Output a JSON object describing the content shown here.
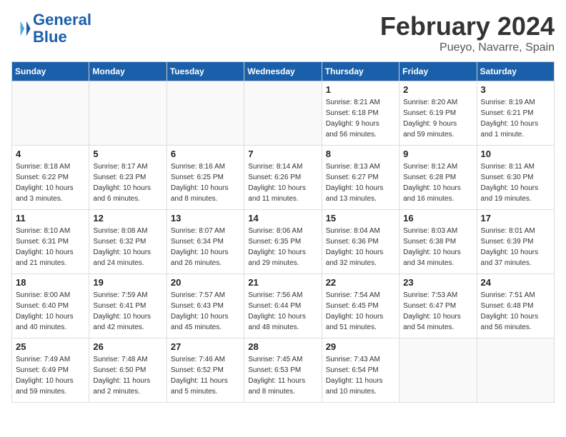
{
  "header": {
    "logo_line1": "General",
    "logo_line2": "Blue",
    "month_year": "February 2024",
    "location": "Pueyo, Navarre, Spain"
  },
  "days_of_week": [
    "Sunday",
    "Monday",
    "Tuesday",
    "Wednesday",
    "Thursday",
    "Friday",
    "Saturday"
  ],
  "weeks": [
    [
      {
        "day": "",
        "info": ""
      },
      {
        "day": "",
        "info": ""
      },
      {
        "day": "",
        "info": ""
      },
      {
        "day": "",
        "info": ""
      },
      {
        "day": "1",
        "info": "Sunrise: 8:21 AM\nSunset: 6:18 PM\nDaylight: 9 hours\nand 56 minutes."
      },
      {
        "day": "2",
        "info": "Sunrise: 8:20 AM\nSunset: 6:19 PM\nDaylight: 9 hours\nand 59 minutes."
      },
      {
        "day": "3",
        "info": "Sunrise: 8:19 AM\nSunset: 6:21 PM\nDaylight: 10 hours\nand 1 minute."
      }
    ],
    [
      {
        "day": "4",
        "info": "Sunrise: 8:18 AM\nSunset: 6:22 PM\nDaylight: 10 hours\nand 3 minutes."
      },
      {
        "day": "5",
        "info": "Sunrise: 8:17 AM\nSunset: 6:23 PM\nDaylight: 10 hours\nand 6 minutes."
      },
      {
        "day": "6",
        "info": "Sunrise: 8:16 AM\nSunset: 6:25 PM\nDaylight: 10 hours\nand 8 minutes."
      },
      {
        "day": "7",
        "info": "Sunrise: 8:14 AM\nSunset: 6:26 PM\nDaylight: 10 hours\nand 11 minutes."
      },
      {
        "day": "8",
        "info": "Sunrise: 8:13 AM\nSunset: 6:27 PM\nDaylight: 10 hours\nand 13 minutes."
      },
      {
        "day": "9",
        "info": "Sunrise: 8:12 AM\nSunset: 6:28 PM\nDaylight: 10 hours\nand 16 minutes."
      },
      {
        "day": "10",
        "info": "Sunrise: 8:11 AM\nSunset: 6:30 PM\nDaylight: 10 hours\nand 19 minutes."
      }
    ],
    [
      {
        "day": "11",
        "info": "Sunrise: 8:10 AM\nSunset: 6:31 PM\nDaylight: 10 hours\nand 21 minutes."
      },
      {
        "day": "12",
        "info": "Sunrise: 8:08 AM\nSunset: 6:32 PM\nDaylight: 10 hours\nand 24 minutes."
      },
      {
        "day": "13",
        "info": "Sunrise: 8:07 AM\nSunset: 6:34 PM\nDaylight: 10 hours\nand 26 minutes."
      },
      {
        "day": "14",
        "info": "Sunrise: 8:06 AM\nSunset: 6:35 PM\nDaylight: 10 hours\nand 29 minutes."
      },
      {
        "day": "15",
        "info": "Sunrise: 8:04 AM\nSunset: 6:36 PM\nDaylight: 10 hours\nand 32 minutes."
      },
      {
        "day": "16",
        "info": "Sunrise: 8:03 AM\nSunset: 6:38 PM\nDaylight: 10 hours\nand 34 minutes."
      },
      {
        "day": "17",
        "info": "Sunrise: 8:01 AM\nSunset: 6:39 PM\nDaylight: 10 hours\nand 37 minutes."
      }
    ],
    [
      {
        "day": "18",
        "info": "Sunrise: 8:00 AM\nSunset: 6:40 PM\nDaylight: 10 hours\nand 40 minutes."
      },
      {
        "day": "19",
        "info": "Sunrise: 7:59 AM\nSunset: 6:41 PM\nDaylight: 10 hours\nand 42 minutes."
      },
      {
        "day": "20",
        "info": "Sunrise: 7:57 AM\nSunset: 6:43 PM\nDaylight: 10 hours\nand 45 minutes."
      },
      {
        "day": "21",
        "info": "Sunrise: 7:56 AM\nSunset: 6:44 PM\nDaylight: 10 hours\nand 48 minutes."
      },
      {
        "day": "22",
        "info": "Sunrise: 7:54 AM\nSunset: 6:45 PM\nDaylight: 10 hours\nand 51 minutes."
      },
      {
        "day": "23",
        "info": "Sunrise: 7:53 AM\nSunset: 6:47 PM\nDaylight: 10 hours\nand 54 minutes."
      },
      {
        "day": "24",
        "info": "Sunrise: 7:51 AM\nSunset: 6:48 PM\nDaylight: 10 hours\nand 56 minutes."
      }
    ],
    [
      {
        "day": "25",
        "info": "Sunrise: 7:49 AM\nSunset: 6:49 PM\nDaylight: 10 hours\nand 59 minutes."
      },
      {
        "day": "26",
        "info": "Sunrise: 7:48 AM\nSunset: 6:50 PM\nDaylight: 11 hours\nand 2 minutes."
      },
      {
        "day": "27",
        "info": "Sunrise: 7:46 AM\nSunset: 6:52 PM\nDaylight: 11 hours\nand 5 minutes."
      },
      {
        "day": "28",
        "info": "Sunrise: 7:45 AM\nSunset: 6:53 PM\nDaylight: 11 hours\nand 8 minutes."
      },
      {
        "day": "29",
        "info": "Sunrise: 7:43 AM\nSunset: 6:54 PM\nDaylight: 11 hours\nand 10 minutes."
      },
      {
        "day": "",
        "info": ""
      },
      {
        "day": "",
        "info": ""
      }
    ]
  ]
}
